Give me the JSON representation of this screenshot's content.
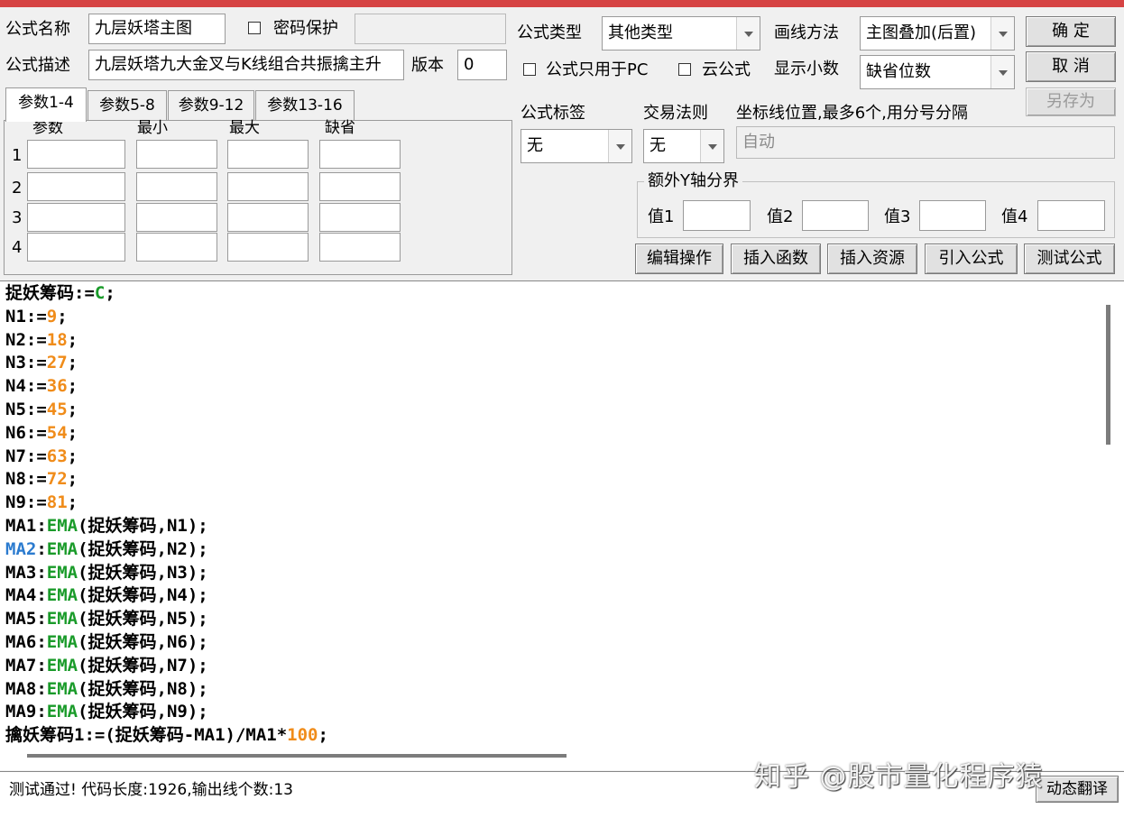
{
  "colors": {
    "title_bar": "#d64343",
    "keyword": "#1a9b2a",
    "number": "#f08c1a",
    "variable": "#2b7bcf"
  },
  "form": {
    "name_label": "公式名称",
    "name_value": "九层妖塔主图",
    "password_label": "密码保护",
    "desc_label": "公式描述",
    "desc_value": "九层妖塔九大金叉与K线组合共振擒主升",
    "version_label": "版本",
    "version_value": "0",
    "type_label": "公式类型",
    "type_value": "其他类型",
    "draw_label": "画线方法",
    "draw_value": "主图叠加(后置)",
    "pc_only_label": "公式只用于PC",
    "cloud_label": "云公式",
    "decimals_label": "显示小数",
    "decimals_value": "缺省位数",
    "tag_label": "公式标签",
    "tag_value": "无",
    "rule_label": "交易法则",
    "rule_value": "无",
    "coord_label": "坐标线位置,最多6个,用分号分隔",
    "coord_value": "自动",
    "yaxis_label": "额外Y轴分界",
    "y_values": [
      "值1",
      "值2",
      "值3",
      "值4"
    ]
  },
  "buttons": {
    "ok": "确  定",
    "cancel": "取  消",
    "save_as": "另存为",
    "edit_ops": "编辑操作",
    "insert_func": "插入函数",
    "insert_res": "插入资源",
    "import_formula": "引入公式",
    "test_formula": "测试公式",
    "dynamic_translate": "动态翻译"
  },
  "params": {
    "tabs": [
      "参数1-4",
      "参数5-8",
      "参数9-12",
      "参数13-16"
    ],
    "headers": [
      "参数",
      "最小",
      "最大",
      "缺省"
    ],
    "rows": [
      "1",
      "2",
      "3",
      "4"
    ]
  },
  "code": [
    [
      {
        "t": "捉妖筹码:="
      },
      {
        "t": "C",
        "c": "kw"
      },
      {
        "t": ";"
      }
    ],
    [
      {
        "t": "N1:="
      },
      {
        "t": "9",
        "c": "num"
      },
      {
        "t": ";"
      }
    ],
    [
      {
        "t": "N2:="
      },
      {
        "t": "18",
        "c": "num"
      },
      {
        "t": ";"
      }
    ],
    [
      {
        "t": "N3:="
      },
      {
        "t": "27",
        "c": "num"
      },
      {
        "t": ";"
      }
    ],
    [
      {
        "t": "N4:="
      },
      {
        "t": "36",
        "c": "num"
      },
      {
        "t": ";"
      }
    ],
    [
      {
        "t": "N5:="
      },
      {
        "t": "45",
        "c": "num"
      },
      {
        "t": ";"
      }
    ],
    [
      {
        "t": "N6:="
      },
      {
        "t": "54",
        "c": "num"
      },
      {
        "t": ";"
      }
    ],
    [
      {
        "t": "N7:="
      },
      {
        "t": "63",
        "c": "num"
      },
      {
        "t": ";"
      }
    ],
    [
      {
        "t": "N8:="
      },
      {
        "t": "72",
        "c": "num"
      },
      {
        "t": ";"
      }
    ],
    [
      {
        "t": "N9:="
      },
      {
        "t": "81",
        "c": "num"
      },
      {
        "t": ";"
      }
    ],
    [
      {
        "t": "MA1:"
      },
      {
        "t": "EMA",
        "c": "kw"
      },
      {
        "t": "(捉妖筹码,N1);"
      }
    ],
    [
      {
        "t": "MA2",
        "c": "var"
      },
      {
        "t": ":"
      },
      {
        "t": "EMA",
        "c": "kw"
      },
      {
        "t": "(捉妖筹码,N2);"
      }
    ],
    [
      {
        "t": "MA3:"
      },
      {
        "t": "EMA",
        "c": "kw"
      },
      {
        "t": "(捉妖筹码,N3);"
      }
    ],
    [
      {
        "t": "MA4:"
      },
      {
        "t": "EMA",
        "c": "kw"
      },
      {
        "t": "(捉妖筹码,N4);"
      }
    ],
    [
      {
        "t": "MA5:"
      },
      {
        "t": "EMA",
        "c": "kw"
      },
      {
        "t": "(捉妖筹码,N5);"
      }
    ],
    [
      {
        "t": "MA6:"
      },
      {
        "t": "EMA",
        "c": "kw"
      },
      {
        "t": "(捉妖筹码,N6);"
      }
    ],
    [
      {
        "t": "MA7:"
      },
      {
        "t": "EMA",
        "c": "kw"
      },
      {
        "t": "(捉妖筹码,N7);"
      }
    ],
    [
      {
        "t": "MA8:"
      },
      {
        "t": "EMA",
        "c": "kw"
      },
      {
        "t": "(捉妖筹码,N8);"
      }
    ],
    [
      {
        "t": "MA9:"
      },
      {
        "t": "EMA",
        "c": "kw"
      },
      {
        "t": "(捉妖筹码,N9);"
      }
    ],
    [
      {
        "t": "擒妖筹码1:=(捉妖筹码-MA1)/MA1*"
      },
      {
        "t": "100",
        "c": "num"
      },
      {
        "t": ";"
      }
    ]
  ],
  "status": "测试通过! 代码长度:1926,输出线个数:13",
  "watermark": "知乎 @股市量化程序猿"
}
